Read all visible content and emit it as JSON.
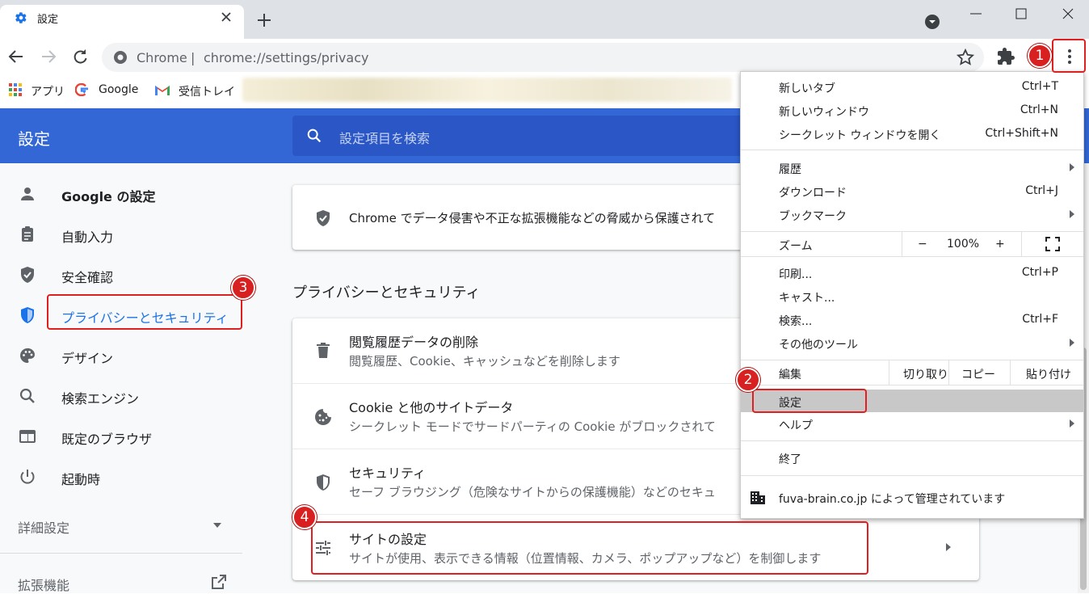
{
  "tab": {
    "title": "設定"
  },
  "toolbar": {
    "site_label": "Chrome",
    "separator": "|",
    "url": "chrome://settings/privacy"
  },
  "bookmarks": [
    {
      "label": "アプリ",
      "icon": "apps-grid-icon"
    },
    {
      "label": "Google",
      "icon": "google-g-icon"
    },
    {
      "label": "受信トレイ",
      "icon": "gmail-icon"
    }
  ],
  "header": {
    "title": "設定",
    "search_placeholder": "設定項目を検索"
  },
  "sidebar": {
    "items": [
      {
        "label": "Google の設定",
        "icon": "person-icon"
      },
      {
        "label": "自動入力",
        "icon": "clipboard-icon"
      },
      {
        "label": "安全確認",
        "icon": "shield-check-icon"
      },
      {
        "label": "プライバシーとセキュリティ",
        "icon": "shield-privacy-icon",
        "active": true
      },
      {
        "label": "デザイン",
        "icon": "palette-icon"
      },
      {
        "label": "検索エンジン",
        "icon": "search-icon"
      },
      {
        "label": "既定のブラウザ",
        "icon": "browser-icon"
      },
      {
        "label": "起動時",
        "icon": "power-icon"
      }
    ],
    "advanced": "詳細設定",
    "extensions": "拡張機能"
  },
  "main": {
    "safety_text": "Chrome でデータ侵害や不正な拡張機能などの脅威から保護されて",
    "section_title": "プライバシーとセキュリティ",
    "rows": [
      {
        "title": "閲覧履歴データの削除",
        "subtitle": "閲覧履歴、Cookie、キャッシュなどを削除します",
        "icon": "trash-icon"
      },
      {
        "title": "Cookie と他のサイトデータ",
        "subtitle": "シークレット モードでサードパーティの Cookie がブロックされて",
        "icon": "cookie-icon"
      },
      {
        "title": "セキュリティ",
        "subtitle": "セーフ ブラウジング（危険なサイトからの保護機能）などのセキュ",
        "icon": "security-shield-icon"
      },
      {
        "title": "サイトの設定",
        "subtitle": "サイトが使用、表示できる情報（位置情報、カメラ、ポップアップなど）を制御します",
        "icon": "tune-icon"
      }
    ]
  },
  "menu": {
    "new_tab": {
      "label": "新しいタブ",
      "shortcut": "Ctrl+T"
    },
    "new_window": {
      "label": "新しいウィンドウ",
      "shortcut": "Ctrl+N"
    },
    "incognito": {
      "label": "シークレット ウィンドウを開く",
      "shortcut": "Ctrl+Shift+N"
    },
    "history": {
      "label": "履歴"
    },
    "downloads": {
      "label": "ダウンロード",
      "shortcut": "Ctrl+J"
    },
    "bookmarks": {
      "label": "ブックマーク"
    },
    "zoom": {
      "label": "ズーム",
      "minus": "−",
      "value": "100%",
      "plus": "+"
    },
    "print": {
      "label": "印刷...",
      "shortcut": "Ctrl+P"
    },
    "cast": {
      "label": "キャスト..."
    },
    "find": {
      "label": "検索...",
      "shortcut": "Ctrl+F"
    },
    "more_tools": {
      "label": "その他のツール"
    },
    "edit": {
      "label": "編集",
      "cut": "切り取り",
      "copy": "コピー",
      "paste": "貼り付け"
    },
    "settings": {
      "label": "設定"
    },
    "help": {
      "label": "ヘルプ"
    },
    "exit": {
      "label": "終了"
    },
    "managed": {
      "label": "fuva-brain.co.jp によって管理されています"
    }
  },
  "annotations": {
    "one": "1",
    "two": "2",
    "three": "3",
    "four": "4"
  },
  "colors": {
    "accent": "#3367d6",
    "annotation_red": "#e02020",
    "active_link": "#1a73e8"
  }
}
